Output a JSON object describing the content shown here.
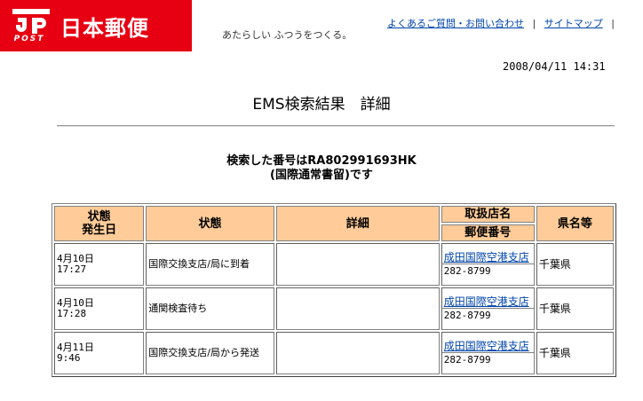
{
  "header": {
    "logo_text": "日本郵便",
    "logo_sub": "POST",
    "tagline": "あたらしい ふつうをつくる。",
    "links": [
      {
        "label": "よくあるご質問・お問い合わせ"
      },
      {
        "label": "サイトマップ"
      }
    ],
    "separator": "|",
    "colors": {
      "brand": "#e60012",
      "table_header": "#ffcc99",
      "link": "#0044aa"
    }
  },
  "timestamp": "2008/04/11 14:31",
  "page_title": "EMS検索結果　詳細",
  "search": {
    "line1": "検索した番号はRA802991693HK",
    "line2": "(国際通常書留)です"
  },
  "table": {
    "headers": {
      "date_line1": "状態",
      "date_line2": "発生日",
      "status": "状態",
      "detail": "詳細",
      "office": "取扱店名",
      "zip": "郵便番号",
      "prefecture": "県名等"
    },
    "rows": [
      {
        "date1": "4月10日",
        "date2": "17:27",
        "status": "国際交換支店/局に到着",
        "detail": "",
        "office": "成田国際空港支店",
        "zip": "282-8799",
        "prefecture": "千葉県"
      },
      {
        "date1": "4月10日",
        "date2": "17:28",
        "status": "通関検査待ち",
        "detail": "",
        "office": "成田国際空港支店",
        "zip": "282-8799",
        "prefecture": "千葉県"
      },
      {
        "date1": "4月11日",
        "date2": "9:46",
        "status": "国際交換支店/局から発送",
        "detail": "",
        "office": "成田国際空港支店",
        "zip": "282-8799",
        "prefecture": "千葉県"
      }
    ]
  }
}
